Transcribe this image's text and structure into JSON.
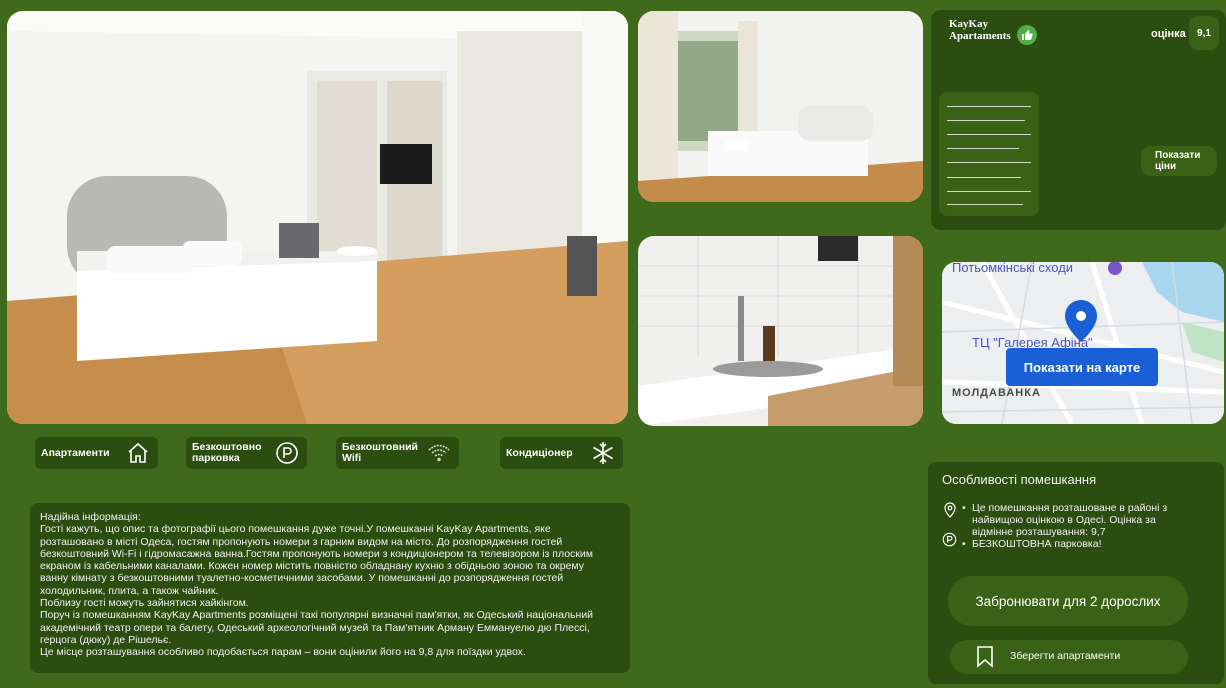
{
  "header": {
    "brand_line1": "KayKay",
    "brand_line2": "Apartaments",
    "rating_label": "оцінка",
    "rating_value": "9,1",
    "show_prices_line1": "Показати",
    "show_prices_line2": "ціни"
  },
  "map": {
    "label_top": "Потьомкінські сходи",
    "label_mall": "ТЦ \"Галерея Афіна\"",
    "district": "МОЛДАВАНКА",
    "button": "Показати на карте"
  },
  "amenities": [
    {
      "line1": "Апартаменти",
      "line2": "",
      "icon": "house-icon"
    },
    {
      "line1": "Безкоштовно",
      "line2": "парковка",
      "icon": "parking-icon"
    },
    {
      "line1": "Безкоштовний",
      "line2": "Wifi",
      "icon": "wifi-icon"
    },
    {
      "line1": "Кондиціонер",
      "line2": "",
      "icon": "snowflake-icon"
    }
  ],
  "description": {
    "lines": [
      "Надійна інформація:",
      "Гості кажуть, що опис та фотографії цього помешкання дуже точні.У помешканні KayKay Apartments, яке розташовано в місті Одеса, гостям пропонують номери з гарним видом на місто. До розпорядження гостей безкоштовний Wi-Fi і гідромасажна ванна.Гостям пропонують номери з кондиціонером та телевізором із плоским екраном із кабельними каналами. Кожен номер містить повністю обладнану кухню з обідньою зоною та окрему ванну кімнату з безкоштовними туалетно-косметичними засобами. У помешканні до розпорядження гостей холодильник, плита, а також чайник.",
      "Поблизу гості можуть зайнятися хайкінгом.",
      "Поруч із помешканням KayKay Apartments розміщені такі популярні визначні пам'ятки, як Одеський національний академічний театр опери та балету, Одеський археологічний музей та Пам'ятник Арману Еммануелю дю Плессі, герцога (дюку) де Рішельє.",
      "Це місце розташування особливо подобається парам – вони оцінили його на 9,8 для поїздки удвох."
    ]
  },
  "features": {
    "title": "Особливості помешкання",
    "item1": "Це помешкання розташоване в районі з найвищою оцінкою в Одесі. Оцінка за відмінне розташування: 9,7",
    "item2": "БЕЗКОШТОВНА парковка!",
    "book_button": "Забронювати для 2 дорослих",
    "save_button": "Зберегти апартаменти"
  },
  "colors": {
    "background": "#3f6a1b",
    "card": "#2b4d10",
    "button": "#3a6217",
    "map_button": "#1a5fd6"
  }
}
